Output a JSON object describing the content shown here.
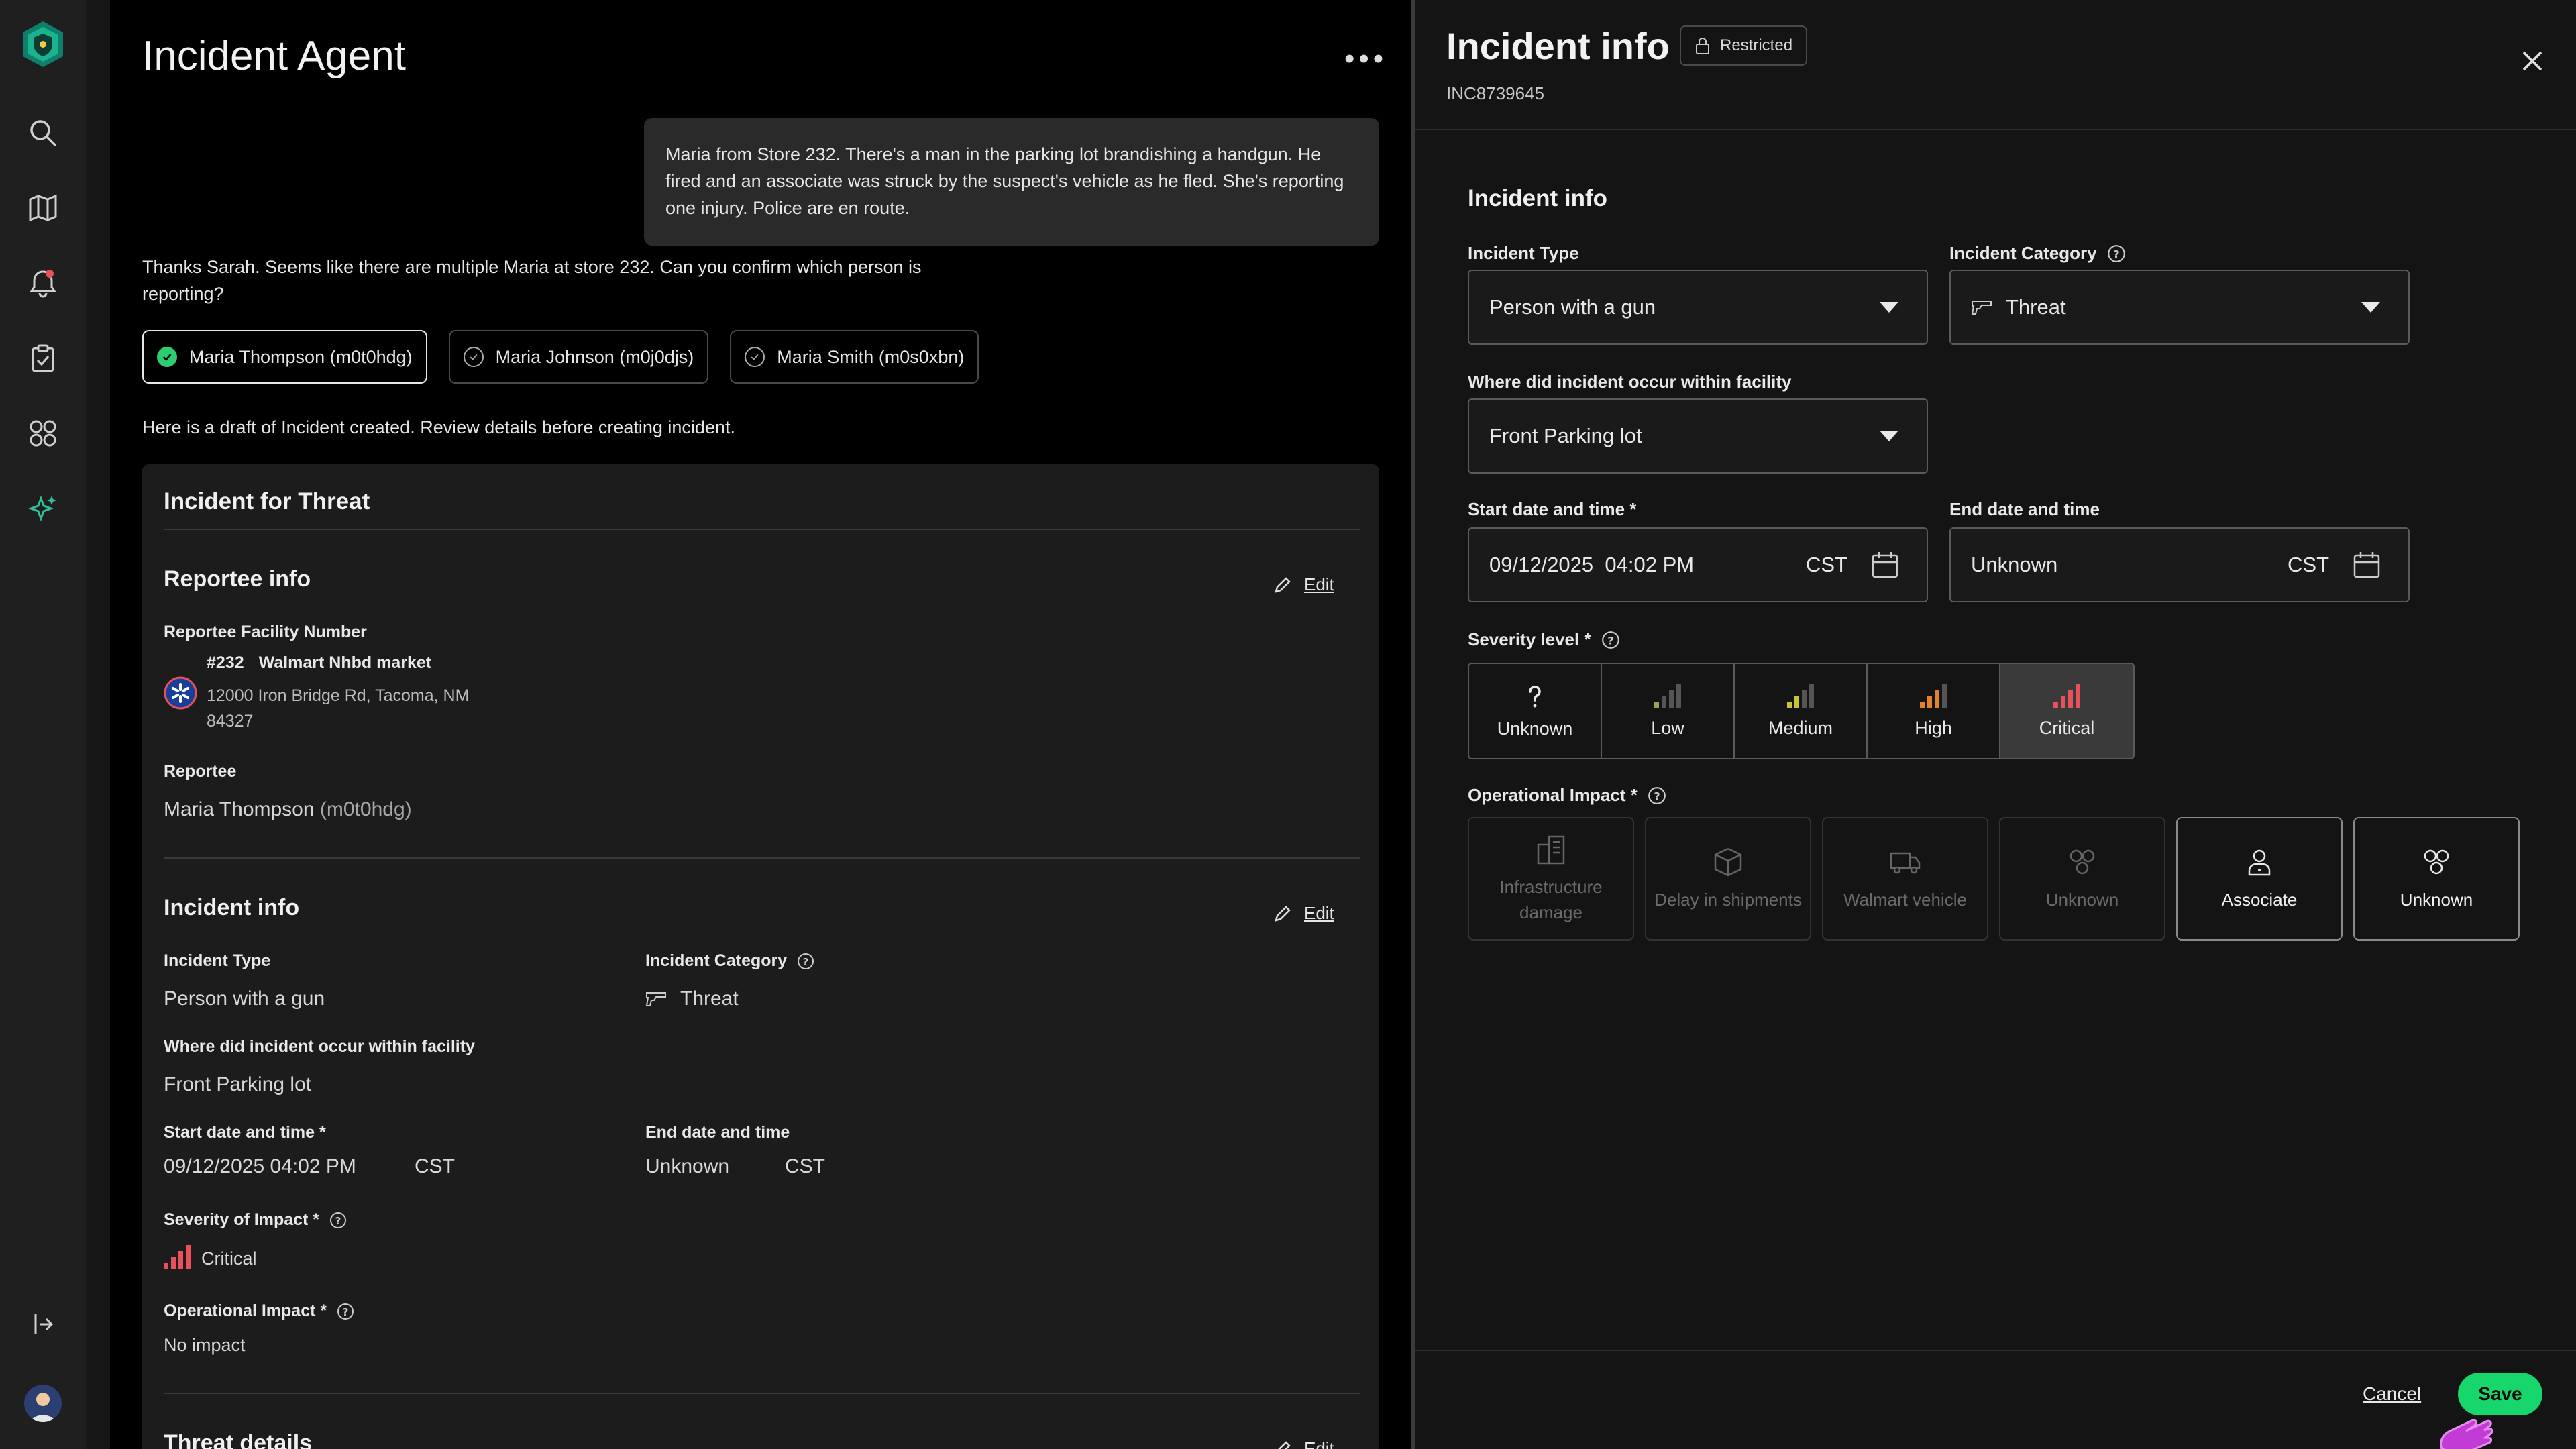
{
  "chat": {
    "title": "Incident Agent",
    "user_message": "Maria from Store 232. There's a man in the parking lot brandishing a handgun. He fired and an associate was struck by the suspect's vehicle as he fled. She's reporting one injury. Police are en route.",
    "agent_message": "Thanks Sarah. Seems like there are multiple Maria at store 232. Can you confirm which person is reporting?",
    "choices": [
      {
        "label": "Maria Thompson (m0t0hdg)",
        "selected": true
      },
      {
        "label": "Maria Johnson (m0j0djs)",
        "selected": false
      },
      {
        "label": "Maria Smith (m0s0xbn)",
        "selected": false
      }
    ],
    "draft_message": "Here is a draft of Incident created. Review details before creating incident."
  },
  "draft_card": {
    "title": "Incident for Threat",
    "edit_label": "Edit",
    "reportee": {
      "section_title": "Reportee info",
      "facility_label": "Reportee Facility Number",
      "facility_number": "#232",
      "facility_name": "Walmart Nhbd market",
      "address_line1": "12000 Iron Bridge Rd, Tacoma, NM",
      "address_line2": "84327",
      "reportee_label": "Reportee",
      "reportee_name": "Maria Thompson",
      "reportee_id": "(m0t0hdg)"
    },
    "incident": {
      "section_title": "Incident info",
      "type_label": "Incident Type",
      "type_value": "Person with a gun",
      "category_label": "Incident Category",
      "category_value": "Threat",
      "where_label": "Where did incident occur within facility",
      "where_value": "Front Parking lot",
      "start_label": "Start date and time *",
      "start_value": "09/12/2025 04:02 PM",
      "start_tz": "CST",
      "end_label": "End date and time",
      "end_value": "Unknown",
      "end_tz": "CST",
      "severity_label": "Severity of Impact *",
      "severity_value": "Critical",
      "ops_label": "Operational Impact *",
      "ops_value": "No impact"
    },
    "threat_title": "Threat details"
  },
  "panel": {
    "title": "Incident info",
    "badge": "Restricted",
    "incident_id": "INC8739645",
    "form_heading": "Incident info",
    "type_label": "Incident Type",
    "type_value": "Person with a gun",
    "category_label": "Incident Category",
    "category_value": "Threat",
    "where_label": "Where did incident occur within facility",
    "where_value": "Front Parking lot",
    "start_label": "Start date and time *",
    "start_date": "09/12/2025",
    "start_time": "04:02 PM",
    "start_tz": "CST",
    "end_label": "End date and time",
    "end_value": "Unknown",
    "end_tz": "CST",
    "severity_label": "Severity level *",
    "severity_options": [
      "Unknown",
      "Low",
      "Medium",
      "High",
      "Critical"
    ],
    "severity_selected": "Critical",
    "ops_label": "Operational Impact *",
    "ops_options": [
      {
        "label": "Infrastructure damage",
        "enabled": false,
        "icon": "building-icon"
      },
      {
        "label": "Delay in shipments",
        "enabled": false,
        "icon": "box-icon"
      },
      {
        "label": "Walmart vehicle",
        "enabled": false,
        "icon": "truck-icon"
      },
      {
        "label": "Unknown",
        "enabled": false,
        "icon": "group-icon"
      },
      {
        "label": "Associate",
        "enabled": true,
        "icon": "person-icon"
      },
      {
        "label": "Unknown",
        "enabled": true,
        "icon": "group-icon"
      }
    ],
    "cancel_label": "Cancel",
    "save_label": "Save"
  },
  "colors": {
    "accent": "#17d66b",
    "brand_rail_icon": "#2fbf9b",
    "severity_low": "#9aa35a",
    "severity_medium": "#c8c23a",
    "severity_high": "#e0822e",
    "severity_critical": "#e8505b"
  }
}
